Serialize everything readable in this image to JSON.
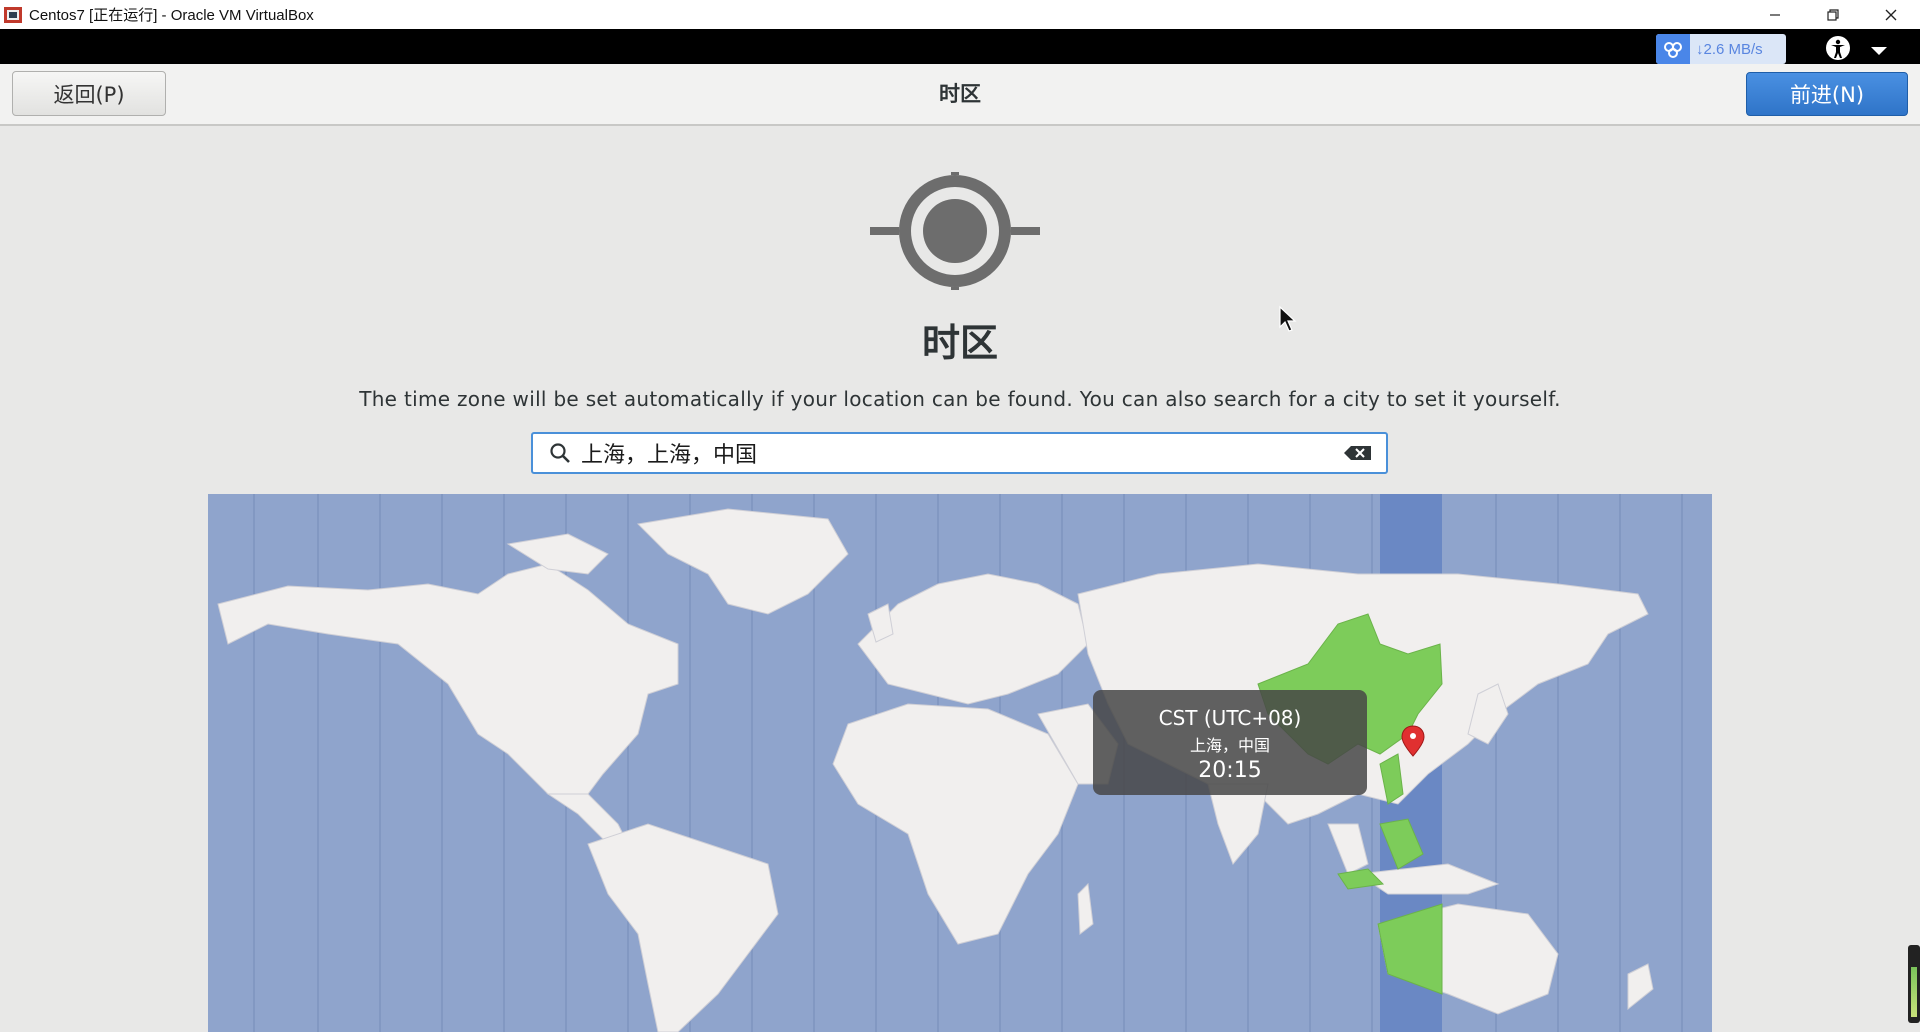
{
  "window": {
    "title": "Centos7 [正在运行] - Oracle VM VirtualBox",
    "controls": [
      "minimize-icon",
      "restore-icon",
      "close-icon"
    ]
  },
  "vm_topbar": {
    "net_speed": "↓2.6 MB/s"
  },
  "header": {
    "back_label": "返回(P)",
    "title": "时区",
    "next_label": "前进(N)"
  },
  "main": {
    "title": "时区",
    "description": "The time zone will be set automatically if your location can be found. You can also search for a city to set it yourself.",
    "search_value": "上海，上海，中国"
  },
  "map": {
    "tooltip": {
      "tz": "CST (UTC+08)",
      "city": "上海，中国",
      "time": "20:15"
    },
    "colors": {
      "ocean": "#8fa4cc",
      "land": "#f1efee",
      "selected_land": "#7dcc5a",
      "selected_band": "#6a88c4",
      "pin": "#e03030"
    }
  }
}
